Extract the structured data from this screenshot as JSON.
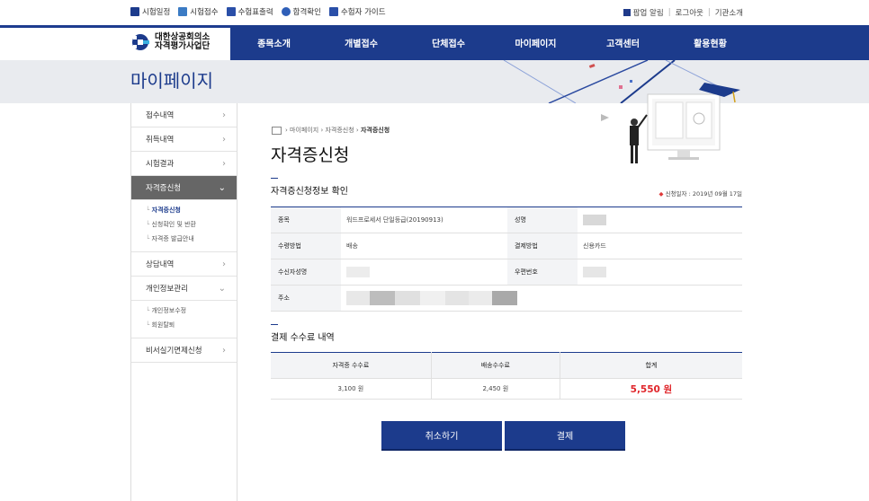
{
  "util": {
    "left": [
      {
        "label": "시험일정",
        "icon": "calendar-icon",
        "color": "#1c3b8c"
      },
      {
        "label": "시험접수",
        "icon": "edit-icon",
        "color": "#3b7bc4"
      },
      {
        "label": "수험표출력",
        "icon": "print-icon",
        "color": "#2a4fa8"
      },
      {
        "label": "합격확인",
        "icon": "person-icon",
        "color": "#2f5fb8"
      },
      {
        "label": "수험자 가이드",
        "icon": "book-icon",
        "color": "#2a4fa8"
      }
    ],
    "right": [
      "팝업 알림",
      "로그아웃",
      "기관소개"
    ]
  },
  "logo": {
    "line1": "대한상공회의소",
    "line2": "자격평가사업단"
  },
  "gnb": [
    "종목소개",
    "개별접수",
    "단체접수",
    "마이페이지",
    "고객센터",
    "활용현황"
  ],
  "visual_title": "마이페이지",
  "lnb": {
    "items": [
      "접수내역",
      "취득내역",
      "시험결과",
      "자격증신청",
      "상담내역",
      "개인정보관리",
      "비서실기면제신청"
    ],
    "sub_cert": [
      "자격증신청",
      "신청확인 및 반환",
      "자격증 발급안내"
    ],
    "sub_personal": [
      "개인정보수정",
      "회원탈퇴"
    ]
  },
  "breadcrumb": [
    "마이페이지",
    "자격증신청",
    "자격증신청"
  ],
  "page_title": "자격증신청",
  "section1": "자격증신청정보 확인",
  "apply_date": "신청일자 : 2019년 09월 17일",
  "info": {
    "item_label": "종목",
    "item_value": "워드프로세서 단일등급(20190913)",
    "name_label": "성명",
    "method_label": "수령방법",
    "method_value": "배송",
    "pay_label": "결제방법",
    "pay_value": "신용카드",
    "recipient_label": "수신자성명",
    "zip_label": "우편번호",
    "addr_label": "주소"
  },
  "section2": "결제 수수료 내역",
  "fee": {
    "headers": [
      "자격증 수수료",
      "배송수수료",
      "합계"
    ],
    "values": [
      "3,100 원",
      "2,450 원",
      "5,550 원"
    ]
  },
  "buttons": {
    "cancel": "취소하기",
    "pay": "결제"
  },
  "colors": {
    "brand": "#1c3b8c",
    "total": "#e0262b"
  }
}
